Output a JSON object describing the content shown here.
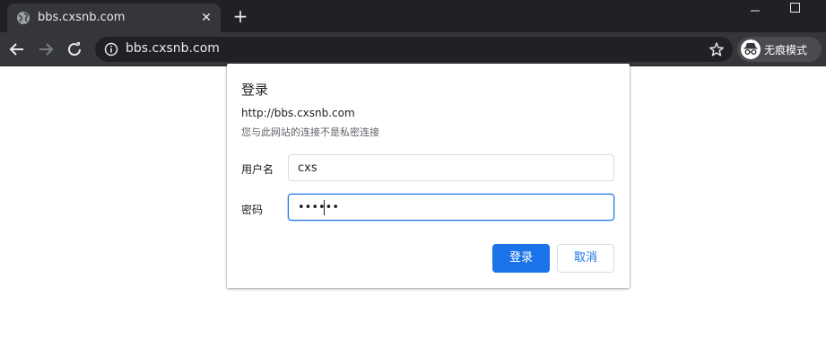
{
  "browser": {
    "tab": {
      "title": "bbs.cxsnb.com",
      "close_glyph": "✕",
      "icon": "globe-icon"
    },
    "new_tab_glyph": "+",
    "address_bar": {
      "url": "bbs.cxsnb.com"
    },
    "incognito_label": "无痕模式",
    "colors": {
      "frame": "#202124",
      "toolbar": "#35363a",
      "text": "#e8eaed"
    }
  },
  "dialog": {
    "title": "登录",
    "origin": "http://bbs.cxsnb.com",
    "warning": "您与此网站的连接不是私密连接",
    "username": {
      "label": "用户名",
      "value": "cxs"
    },
    "password": {
      "label": "密码",
      "value": "••••••"
    },
    "buttons": {
      "sign_in": "登录",
      "cancel": "取消"
    },
    "colors": {
      "accent": "#1a73e8"
    }
  }
}
